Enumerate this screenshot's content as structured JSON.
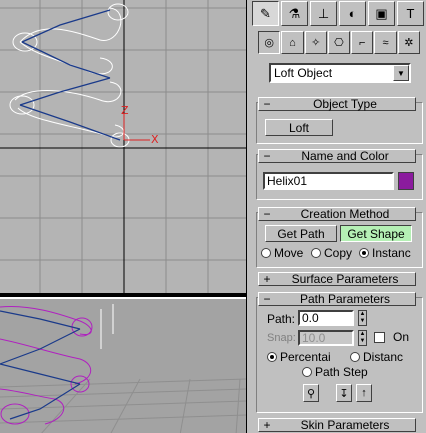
{
  "viewport_top": {
    "axis_z": "Z",
    "axis_x": "X"
  },
  "panel": {
    "tabs": [
      {
        "icon": "create-icon"
      },
      {
        "icon": "modify-icon"
      },
      {
        "icon": "hierarchy-icon"
      },
      {
        "icon": "motion-icon"
      },
      {
        "icon": "display-icon"
      },
      {
        "icon": "utilities-icon"
      }
    ],
    "categories": [
      {
        "icon": "geometry-icon"
      },
      {
        "icon": "shapes-icon"
      },
      {
        "icon": "lights-icon"
      },
      {
        "icon": "cameras-icon"
      },
      {
        "icon": "helpers-icon"
      },
      {
        "icon": "spacewarps-icon"
      },
      {
        "icon": "systems-icon"
      }
    ],
    "object_type_dropdown": "Loft Object",
    "object_type": {
      "sign": "−",
      "title": "Object Type",
      "loft_button": "Loft"
    },
    "name_color": {
      "sign": "−",
      "title": "Name and Color",
      "name_value": "Helix01",
      "color": "#8b1b9e"
    },
    "creation_method": {
      "sign": "−",
      "title": "Creation Method",
      "get_path": "Get Path",
      "get_shape": "Get Shape",
      "move": "Move",
      "copy": "Copy",
      "instance": "Instanc"
    },
    "surface_parameters": {
      "sign": "+",
      "title": "Surface Parameters"
    },
    "path_parameters": {
      "sign": "−",
      "title": "Path Parameters",
      "path_label": "Path:",
      "path_value": "0.0",
      "snap_label": "Snap:",
      "snap_value": "10.0",
      "on_label": "On",
      "percentage": "Percentai",
      "distance": "Distanc",
      "path_steps": "Path Step"
    },
    "skin_parameters": {
      "sign": "+",
      "title": "Skin Parameters"
    }
  }
}
